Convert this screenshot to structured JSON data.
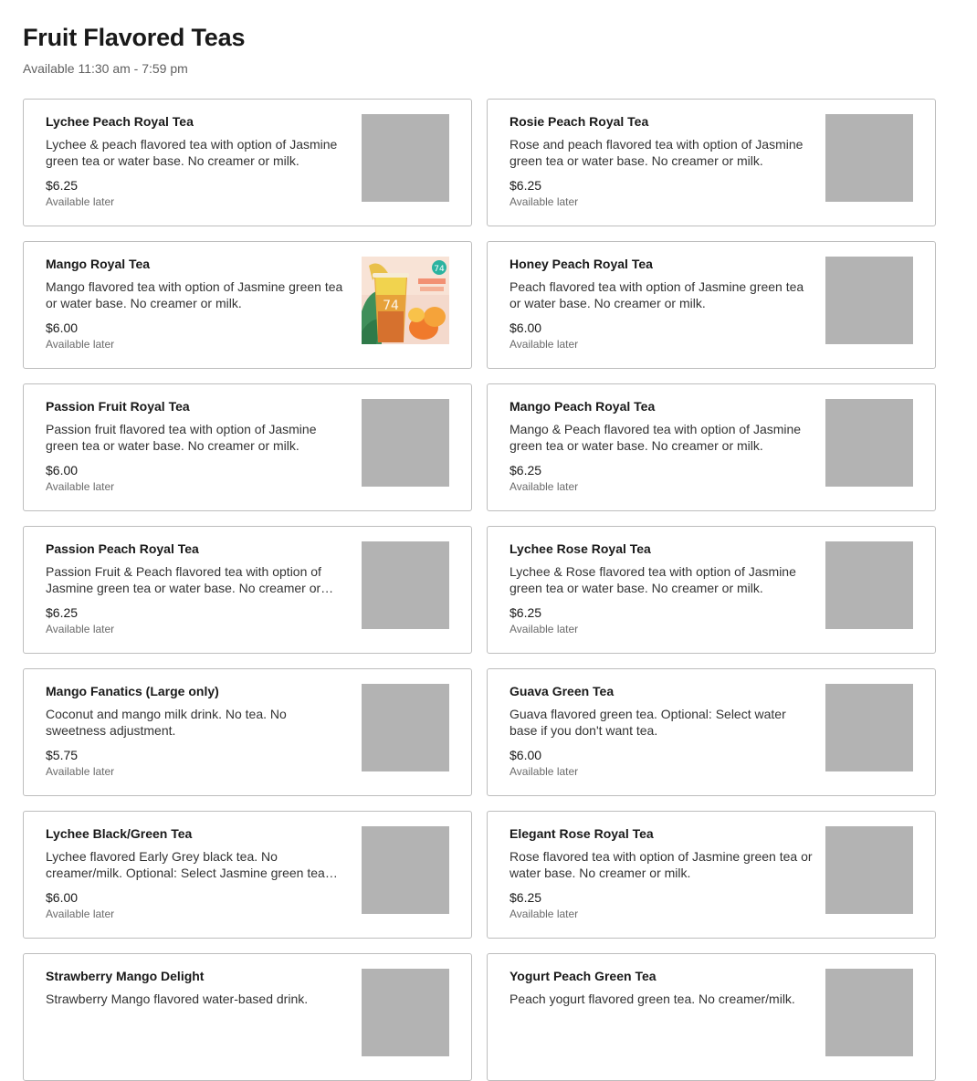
{
  "section": {
    "title": "Fruit Flavored Teas",
    "hours": "Available 11:30 am - 7:59 pm"
  },
  "items": [
    {
      "name": "Lychee Peach Royal Tea",
      "description": "Lychee & peach flavored tea with option of Jasmine green tea or water base. No creamer or milk.",
      "price": "$6.25",
      "availability": "Available later",
      "has_photo": false
    },
    {
      "name": "Rosie Peach Royal Tea",
      "description": "Rose and peach flavored tea with option of Jasmine green tea or water base. No creamer or milk.",
      "price": "$6.25",
      "availability": "Available later",
      "has_photo": false
    },
    {
      "name": "Mango Royal Tea",
      "description": "Mango flavored tea with option of Jasmine green tea or water base. No creamer or milk.",
      "price": "$6.00",
      "availability": "Available later",
      "has_photo": true
    },
    {
      "name": "Honey Peach Royal Tea",
      "description": "Peach flavored tea with option of Jasmine green tea or water base. No creamer or milk.",
      "price": "$6.00",
      "availability": "Available later",
      "has_photo": false
    },
    {
      "name": "Passion Fruit Royal Tea",
      "description": "Passion fruit flavored tea with option of Jasmine green tea or water base. No creamer or milk.",
      "price": "$6.00",
      "availability": "Available later",
      "has_photo": false
    },
    {
      "name": "Mango Peach Royal Tea",
      "description": "Mango & Peach flavored tea with option of Jasmine green tea or water base. No creamer or milk.",
      "price": "$6.25",
      "availability": "Available later",
      "has_photo": false
    },
    {
      "name": "Passion Peach Royal Tea",
      "description": "Passion Fruit & Peach flavored tea with option of Jasmine green tea or water base. No creamer or milk.",
      "price": "$6.25",
      "availability": "Available later",
      "has_photo": false
    },
    {
      "name": "Lychee Rose Royal Tea",
      "description": "Lychee & Rose flavored tea with option of Jasmine green tea or water base. No creamer or milk.",
      "price": "$6.25",
      "availability": "Available later",
      "has_photo": false
    },
    {
      "name": "Mango Fanatics (Large only)",
      "description": "Coconut and mango milk drink. No tea. No sweetness adjustment.",
      "price": "$5.75",
      "availability": "Available later",
      "has_photo": false
    },
    {
      "name": "Guava Green Tea",
      "description": "Guava flavored green tea. Optional: Select water base if you don't want tea.",
      "price": "$6.00",
      "availability": "Available later",
      "has_photo": false
    },
    {
      "name": "Lychee Black/Green Tea",
      "description": "Lychee flavored Early Grey black tea. No creamer/milk. Optional: Select Jasmine green tea base.",
      "price": "$6.00",
      "availability": "Available later",
      "has_photo": false
    },
    {
      "name": "Elegant Rose Royal Tea",
      "description": "Rose flavored tea with option of Jasmine green tea or water base. No creamer or milk.",
      "price": "$6.25",
      "availability": "Available later",
      "has_photo": false
    },
    {
      "name": "Strawberry Mango Delight",
      "description": "Strawberry Mango flavored water-based drink.",
      "price": "",
      "availability": "",
      "has_photo": false
    },
    {
      "name": "Yogurt Peach Green Tea",
      "description": "Peach yogurt flavored green tea. No creamer/milk.",
      "price": "",
      "availability": "",
      "has_photo": false
    }
  ],
  "colors": {
    "card_border": "#bdbdbd",
    "image_placeholder": "#b3b3b3",
    "text_primary": "#191919",
    "text_secondary": "#6b6b6b"
  }
}
